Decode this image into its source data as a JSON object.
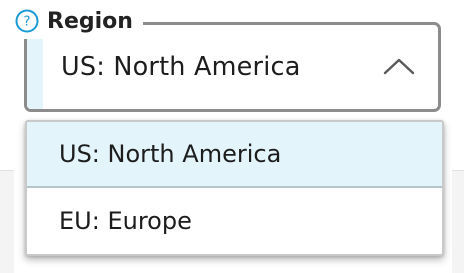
{
  "field": {
    "label": "Region",
    "help_icon": "question-circle-icon",
    "selected_value": "US: North America",
    "chevron_icon": "chevron-up-icon",
    "accent_color": "#1a9ad6",
    "highlight_color": "#e3f4fb"
  },
  "dropdown": {
    "options": [
      {
        "label": "US: North America",
        "highlighted": true
      },
      {
        "label": "EU: Europe",
        "highlighted": false
      }
    ]
  }
}
